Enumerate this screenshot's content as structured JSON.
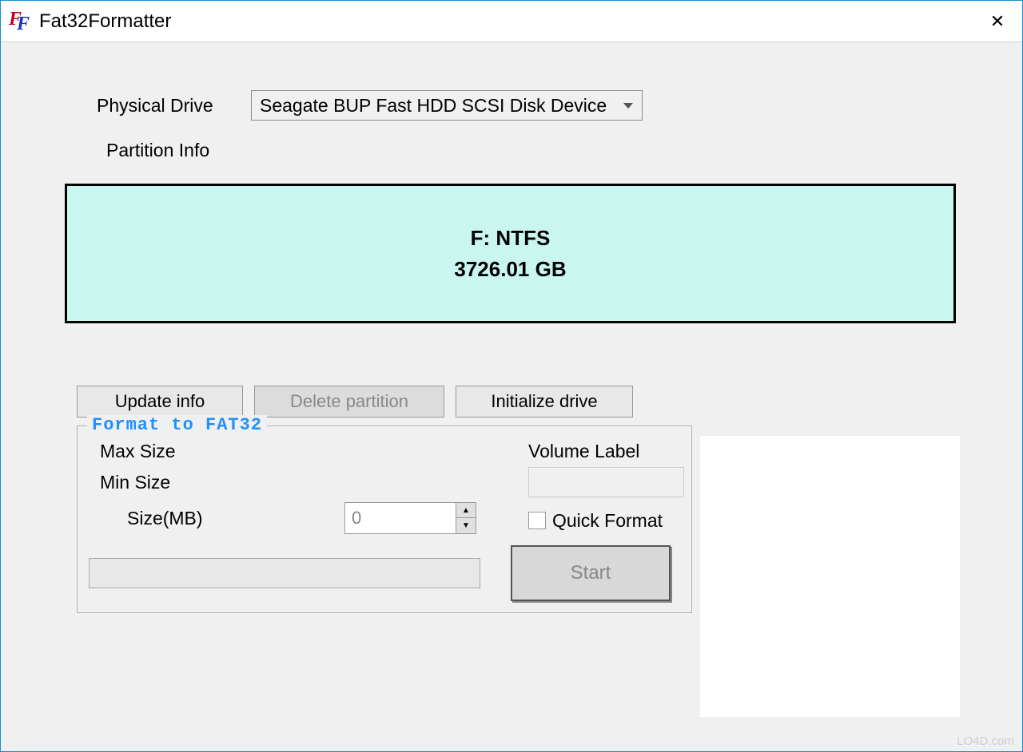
{
  "window": {
    "title": "Fat32Formatter"
  },
  "form": {
    "physical_drive_label": "Physical Drive",
    "physical_drive_value": "Seagate BUP Fast HDD SCSI Disk Device",
    "partition_info_label": "Partition Info"
  },
  "partition": {
    "drive_fs": "F: NTFS",
    "size": "3726.01 GB"
  },
  "buttons": {
    "update_info": "Update info",
    "delete_partition": "Delete partition",
    "initialize_drive": "Initialize drive"
  },
  "groupbox": {
    "title": "Format to FAT32",
    "max_size_label": "Max Size",
    "min_size_label": "Min Size",
    "size_mb_label": "Size(MB)",
    "size_value": "0",
    "volume_label": "Volume Label",
    "volume_value": "",
    "quick_format_label": "Quick Format",
    "start_label": "Start"
  },
  "footer": {
    "watermark": "LO4D.com"
  }
}
